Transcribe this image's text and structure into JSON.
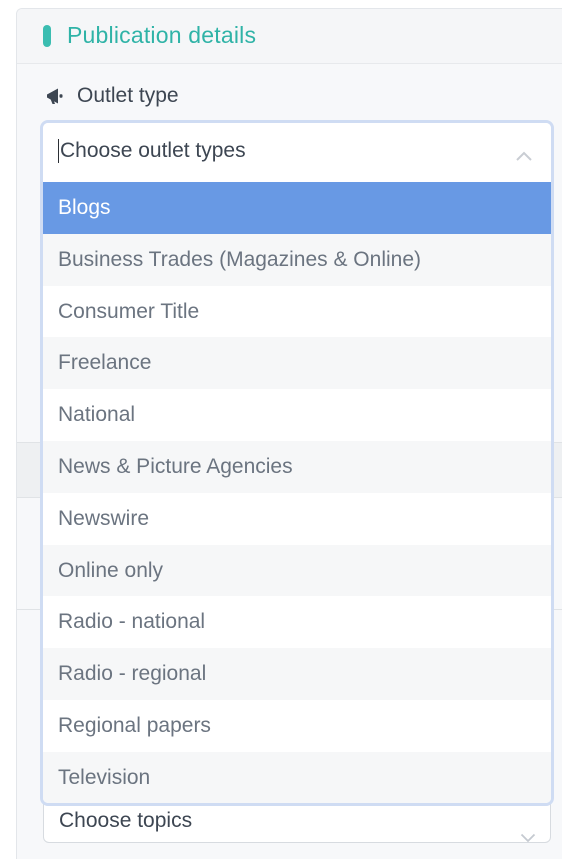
{
  "panel": {
    "title": "Publication details",
    "accent_color": "#3bbdb1"
  },
  "outlet": {
    "label": "Outlet type",
    "icon": "megaphone-icon",
    "placeholder": "Choose outlet types",
    "expanded": true,
    "highlighted_option": "Blogs",
    "highlight_color": "#6899e4",
    "options": [
      "Blogs",
      "Business Trades (Magazines & Online)",
      "Consumer Title",
      "Freelance",
      "National",
      "News & Picture Agencies",
      "Newswire",
      "Online only",
      "Radio - national",
      "Radio - regional",
      "Regional papers",
      "Television"
    ]
  },
  "topics": {
    "placeholder": "Choose topics"
  }
}
